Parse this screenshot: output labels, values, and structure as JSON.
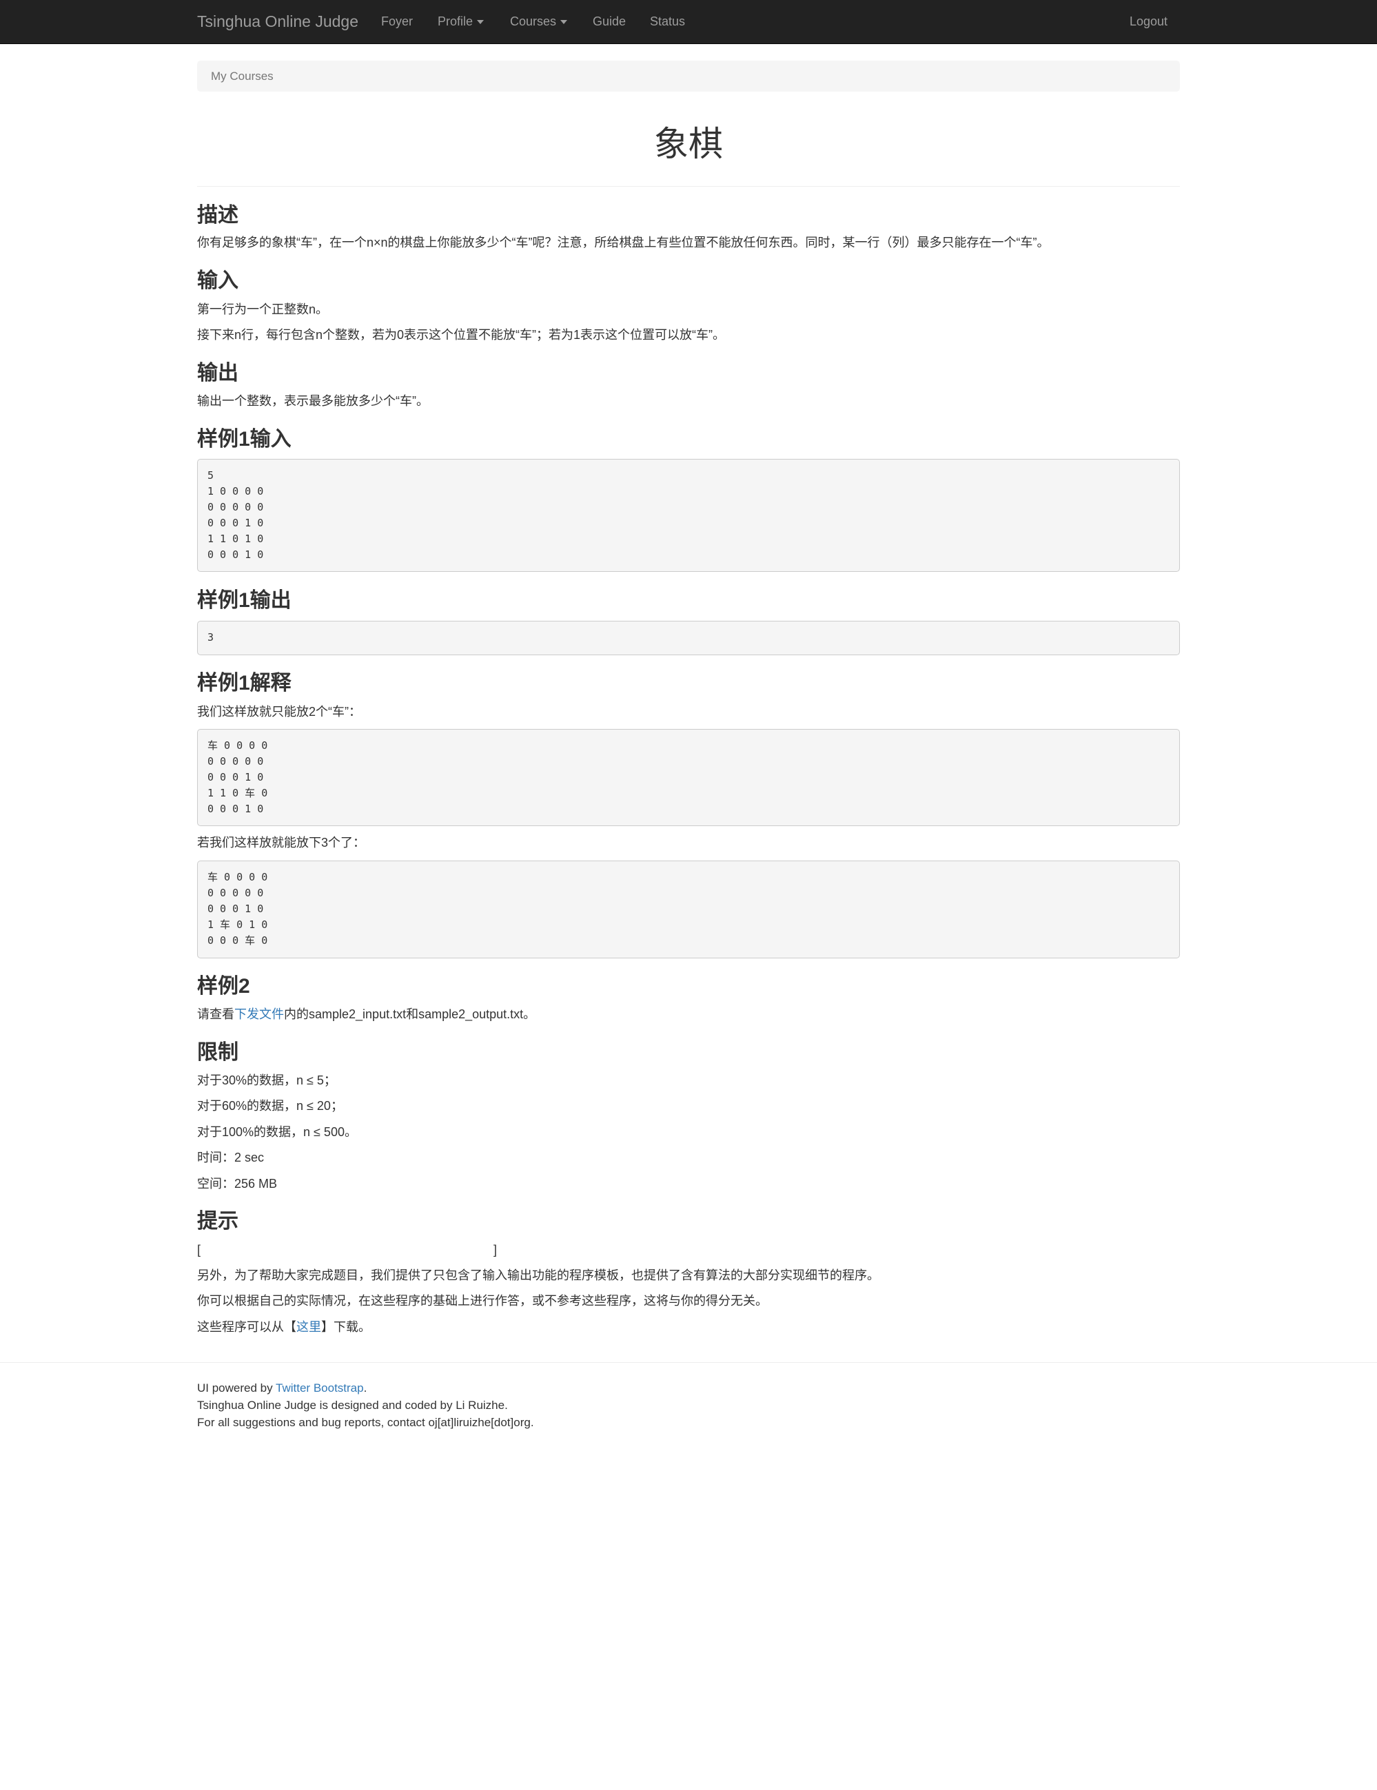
{
  "navbar": {
    "brand": "Tsinghua Online Judge",
    "items": [
      {
        "label": "Foyer"
      },
      {
        "label": "Profile"
      },
      {
        "label": "Courses"
      },
      {
        "label": "Guide"
      },
      {
        "label": "Status"
      }
    ],
    "logout": "Logout"
  },
  "breadcrumb": {
    "label": "My Courses"
  },
  "title": "象棋",
  "description": {
    "heading": "描述",
    "text": "你有足够多的象棋“车”，在一个n×n的棋盘上你能放多少个“车”呢？注意，所给棋盘上有些位置不能放任何东西。同时，某一行（列）最多只能存在一个“车”。"
  },
  "input": {
    "heading": "输入",
    "lines": [
      "第一行为一个正整数n。",
      "接下来n行，每行包含n个整数，若为0表示这个位置不能放“车”；若为1表示这个位置可以放“车”。"
    ]
  },
  "output": {
    "heading": "输出",
    "text": "输出一个整数，表示最多能放多少个“车”。"
  },
  "sample1_input": {
    "heading": "样例1输入",
    "code": "5\n1 0 0 0 0\n0 0 0 0 0\n0 0 0 1 0\n1 1 0 1 0\n0 0 0 1 0"
  },
  "sample1_output": {
    "heading": "样例1输出",
    "code": "3"
  },
  "sample1_explain": {
    "heading": "样例1解释",
    "text1": "我们这样放就只能放2个“车”：",
    "code1": "车 0 0 0 0\n0 0 0 0 0\n0 0 0 1 0\n1 1 0 车 0\n0 0 0 1 0",
    "text2": "若我们这样放就能放下3个了：",
    "code2": "车 0 0 0 0\n0 0 0 0 0\n0 0 0 1 0\n1 车 0 1 0\n0 0 0 车 0"
  },
  "sample2": {
    "heading": "样例2",
    "prefix": "请查看",
    "link": "下发文件",
    "suffix": "内的sample2_input.txt和sample2_output.txt。"
  },
  "limits": {
    "heading": "限制",
    "lines": [
      "对于30%的数据，n ≤ 5；",
      "对于60%的数据，n ≤ 20；",
      "对于100%的数据，n ≤ 500。",
      "时间：2 sec",
      "空间：256 MB"
    ]
  },
  "hint": {
    "heading": "提示",
    "bracket_open": "[",
    "bracket_close": "]",
    "line1": "另外，为了帮助大家完成题目，我们提供了只包含了输入输出功能的程序模板，也提供了含有算法的大部分实现细节的程序。",
    "line2": "你可以根据自己的实际情况，在这些程序的基础上进行作答，或不参考这些程序，这将与你的得分无关。",
    "line3_prefix": "这些程序可以从【",
    "line3_link": "这里",
    "line3_suffix": "】下载。"
  },
  "footer": {
    "powered_prefix": "UI powered by ",
    "powered_link": "Twitter Bootstrap",
    "powered_suffix": ".",
    "line2": "Tsinghua Online Judge is designed and coded by Li Ruizhe.",
    "line3": "For all suggestions and bug reports, contact oj[at]liruizhe[dot]org."
  },
  "colors": {
    "navbar_bg": "#222222",
    "nav_text": "#9d9d9d",
    "link": "#337ab7",
    "code_bg": "#f5f5f5"
  }
}
